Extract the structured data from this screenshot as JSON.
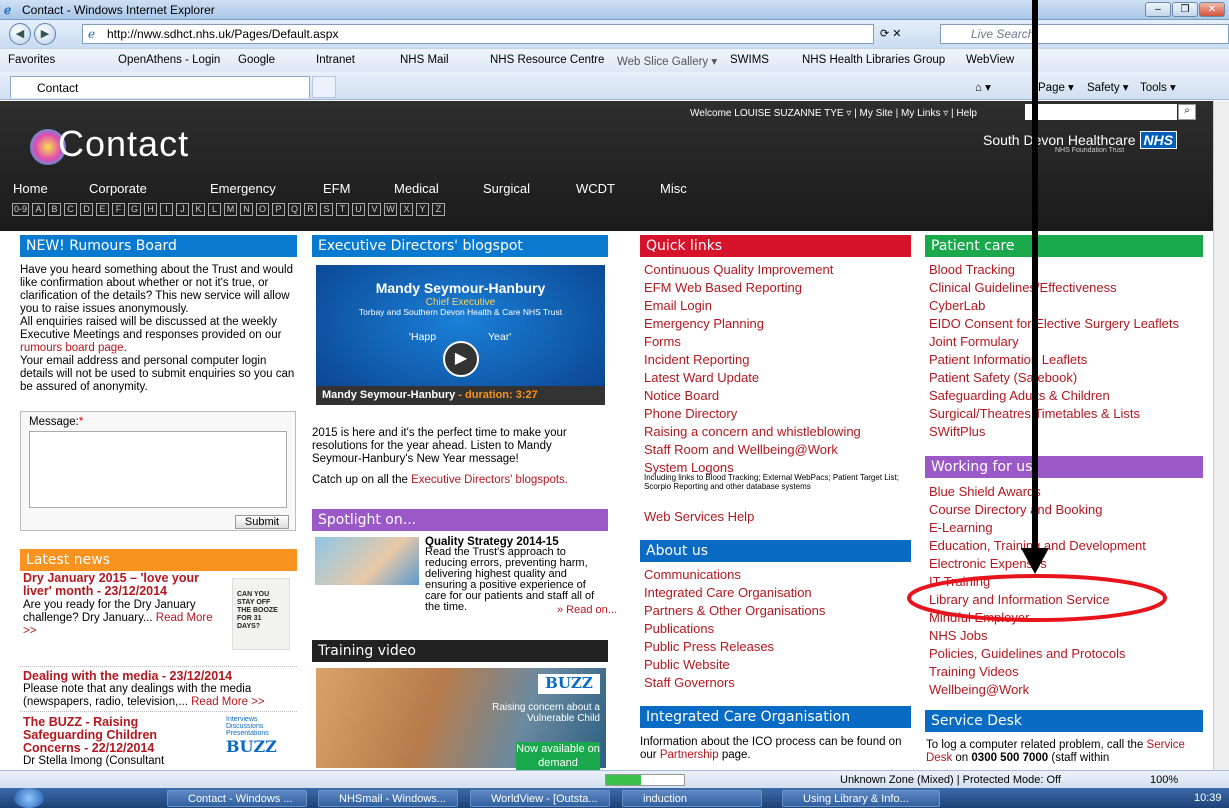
{
  "window": {
    "title": "Contact - Windows Internet Explorer"
  },
  "address": {
    "url": "http://nww.sdhct.nhs.uk/Pages/Default.aspx",
    "search_placeholder": "Live Search"
  },
  "favorites": [
    "Favorites",
    "OpenAthens - Login",
    "Google",
    "Intranet",
    "NHS Mail",
    "NHS Resource Centre",
    "Web Slice Gallery ▾",
    "SWIMS",
    "NHS Health Libraries Group",
    "WebView"
  ],
  "tab": {
    "label": "Contact"
  },
  "cmdbar": {
    "page": "Page ▾",
    "safety": "Safety ▾",
    "tools": "Tools ▾"
  },
  "header": {
    "welcome": "Welcome LOUISE SUZANNE TYE ▿ | My Site | My Links ▿ | Help",
    "logo": "Contact",
    "org": "South Devon Healthcare",
    "nhs": "NHS",
    "trust": "NHS Foundation Trust",
    "nav": [
      "Home",
      "Corporate",
      "Emergency",
      "EFM",
      "Medical",
      "Surgical",
      "WCDT",
      "Misc"
    ],
    "az": [
      "0-9",
      "A",
      "B",
      "C",
      "D",
      "E",
      "F",
      "G",
      "H",
      "I",
      "J",
      "K",
      "L",
      "M",
      "N",
      "O",
      "P",
      "Q",
      "R",
      "S",
      "T",
      "U",
      "V",
      "W",
      "X",
      "Y",
      "Z"
    ]
  },
  "rumours": {
    "title": "NEW! Rumours Board",
    "text1": "Have you heard something about the Trust and would like confirmation about whether or not it's true, or clarification of the details? This new service will allow you to raise issues anonymously.",
    "text2": "All enquiries raised will be discussed at the weekly Executive Meetings and responses provided on our",
    "link": "rumours board page",
    "text3": "Your email address and personal computer login details will not be used to submit enquiries so you can be assured of anonymity.",
    "message_label": "Message:",
    "submit": "Submit"
  },
  "latest": {
    "title": "Latest news",
    "items": [
      {
        "head": "Dry January 2015 – 'love your liver' month - 23/12/2014",
        "text": "Are you ready for the Dry January challenge? Dry January...",
        "more": "Read More >>"
      },
      {
        "head": "Dealing with the media - 23/12/2014",
        "text": "Please note that any dealings with the media (newspapers, radio, television,...",
        "more": "Read More >>"
      },
      {
        "head": "The BUZZ - Raising Safeguarding Children Concerns - 22/12/2014",
        "text": "Dr Stella Imong (Consultant",
        "more": ""
      }
    ],
    "poster": "CAN YOU STAY OFF THE BOOZE FOR 31 DAYS?",
    "buzz_label": "Interviews Discussions Presentations",
    "buzz_logo": "BUZZ"
  },
  "blog": {
    "title": "Executive Directors' blogspot",
    "video_name": "Mandy Seymour-Hanbury",
    "video_role": "Chief Executive",
    "video_org": "Torbay and Southern Devon Health & Care NHS Trust",
    "video_msg_left": "'Happ",
    "video_msg_right": "Year'",
    "caption": "Mandy Seymour-Hanbury",
    "duration": "- duration: 3:27",
    "text": "2015 is here and it's the perfect time to make your resolutions for the year ahead. Listen to Mandy Seymour-Hanbury's New Year message!",
    "catchup": "Catch up on all the",
    "catchup_link": "Executive Directors' blogspots."
  },
  "spotlight": {
    "title": "Spotlight on...",
    "head": "Quality Strategy 2014-15",
    "text": "Read the Trust's approach to reducing errors, preventing harm, delivering highest quality and ensuring a positive experience of care for our patients and staff all of the time.",
    "more": "» Read on..."
  },
  "training": {
    "title": "Training video",
    "buzz": "BUZZ",
    "caption1": "Raising concern about a Vulnerable Child",
    "caption2": "Now available on demand"
  },
  "quick": {
    "title": "Quick links",
    "items": [
      "Continuous Quality Improvement",
      "EFM Web Based Reporting",
      "Email Login",
      "Emergency Planning",
      "Forms",
      "Incident Reporting",
      "Latest Ward Update",
      "Notice Board",
      "Phone Directory",
      "Raising a concern and whistleblowing",
      "Staff Room and Wellbeing@Work",
      "System Logons"
    ],
    "syslogons_note": "Including links to Blood Tracking; External WebPacs; Patient Target List; Scorpio Reporting and other database systems",
    "webhelp": "Web Services Help"
  },
  "about": {
    "title": "About us",
    "items": [
      "Communications",
      "Integrated Care Organisation",
      "Partners & Other Organisations",
      "Publications",
      "Public Press Releases",
      "Public Website",
      "Staff Governors"
    ]
  },
  "ico": {
    "title": "Integrated Care Organisation",
    "text": "Information about the ICO process can be found on our",
    "link": "Partnership",
    "tail": "page."
  },
  "patient": {
    "title": "Patient care",
    "items": [
      "Blood Tracking",
      "Clinical Guidelines/Effectiveness",
      "CyberLab",
      "EIDO Consent for Elective Surgery Leaflets",
      "Joint Formulary",
      "Patient Information Leaflets",
      "Patient Safety (Safebook)",
      "Safeguarding Adults & Children",
      "Surgical/Theatres Timetables & Lists",
      "SWiftPlus"
    ]
  },
  "working": {
    "title": "Working for us",
    "items": [
      "Blue Shield Awards",
      "Course Directory and Booking",
      "E-Learning",
      "Education, Training and Development",
      "Electronic Expenses",
      "IT Training",
      "Library and Information Service",
      "Mindful Employer",
      "NHS Jobs",
      "Policies, Guidelines and Protocols",
      "Training Videos",
      "Wellbeing@Work"
    ]
  },
  "servicedesk": {
    "title": "Service Desk",
    "text": "To log a computer related problem, call the",
    "link": "Service Desk",
    "on": "on",
    "phone": "0300 500 7000",
    "tail": "(staff within"
  },
  "status": {
    "zone": "Unknown Zone (Mixed) | Protected Mode: Off",
    "zoom": "100%"
  },
  "taskbar": {
    "items": [
      "Contact - Windows ...",
      "NHSmail - Windows...",
      "WorldView - [Outsta...",
      "induction",
      "Using Library & Info..."
    ],
    "time": "10:39"
  },
  "colors": {
    "annotation": "#e8141b",
    "link": "#b3181f"
  }
}
